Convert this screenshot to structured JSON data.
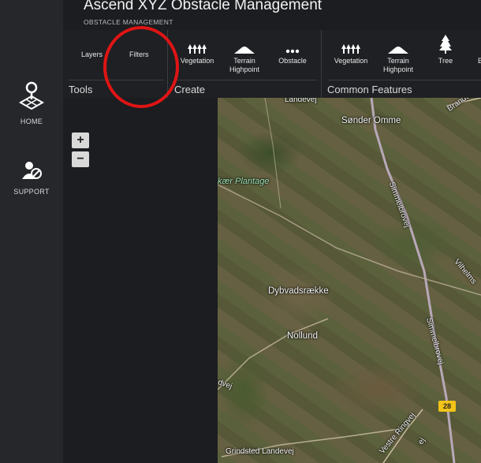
{
  "app": {
    "title": "Ascend XYZ Obstacle Management",
    "subtitle": "OBSTACLE MANAGEMENT"
  },
  "sidebar": {
    "items": [
      {
        "label": "HOME",
        "icon": "home-map-pin-icon"
      },
      {
        "label": "SUPPORT",
        "icon": "support-user-icon"
      }
    ]
  },
  "ribbon": {
    "tools": {
      "label": "Tools",
      "buttons": [
        {
          "label": "Layers"
        },
        {
          "label": "Filters"
        }
      ]
    },
    "create": {
      "label": "Create",
      "buttons": [
        {
          "label": "Vegetation",
          "icon": "vegetation-icon"
        },
        {
          "label": "Terrain Highpoint",
          "line1": "Terrain",
          "line2": "Highpoint",
          "icon": "terrain-icon"
        },
        {
          "label": "Obstacle",
          "icon": "more-dots-icon"
        }
      ]
    },
    "common": {
      "label": "Common Features",
      "buttons": [
        {
          "label": "Vegetation",
          "icon": "vegetation-icon"
        },
        {
          "label": "Terrain Highpoint",
          "line1": "Terrain",
          "line2": "Highpoint",
          "icon": "terrain-icon"
        },
        {
          "label": "Tree",
          "icon": "tree-icon"
        },
        {
          "label": "B",
          "icon": "building-icon"
        }
      ]
    }
  },
  "map": {
    "zoom_in": "+",
    "zoom_out": "−",
    "places": [
      "Sønder Omme",
      "Simmelbrovej",
      "kær Plantage",
      "Dybvadsrække",
      "Nollund",
      "Simmelbrovej",
      "Grindsted Landevej",
      "Vestre Ringvej",
      "Brande L",
      "Vilhelms",
      "dvej",
      "Landevej",
      "ej"
    ],
    "road_number": "28"
  },
  "colors": {
    "background": "#1b1d20",
    "sidebar": "#25272b",
    "annotation_red": "#e01414",
    "road_badge": "#f2c318"
  }
}
